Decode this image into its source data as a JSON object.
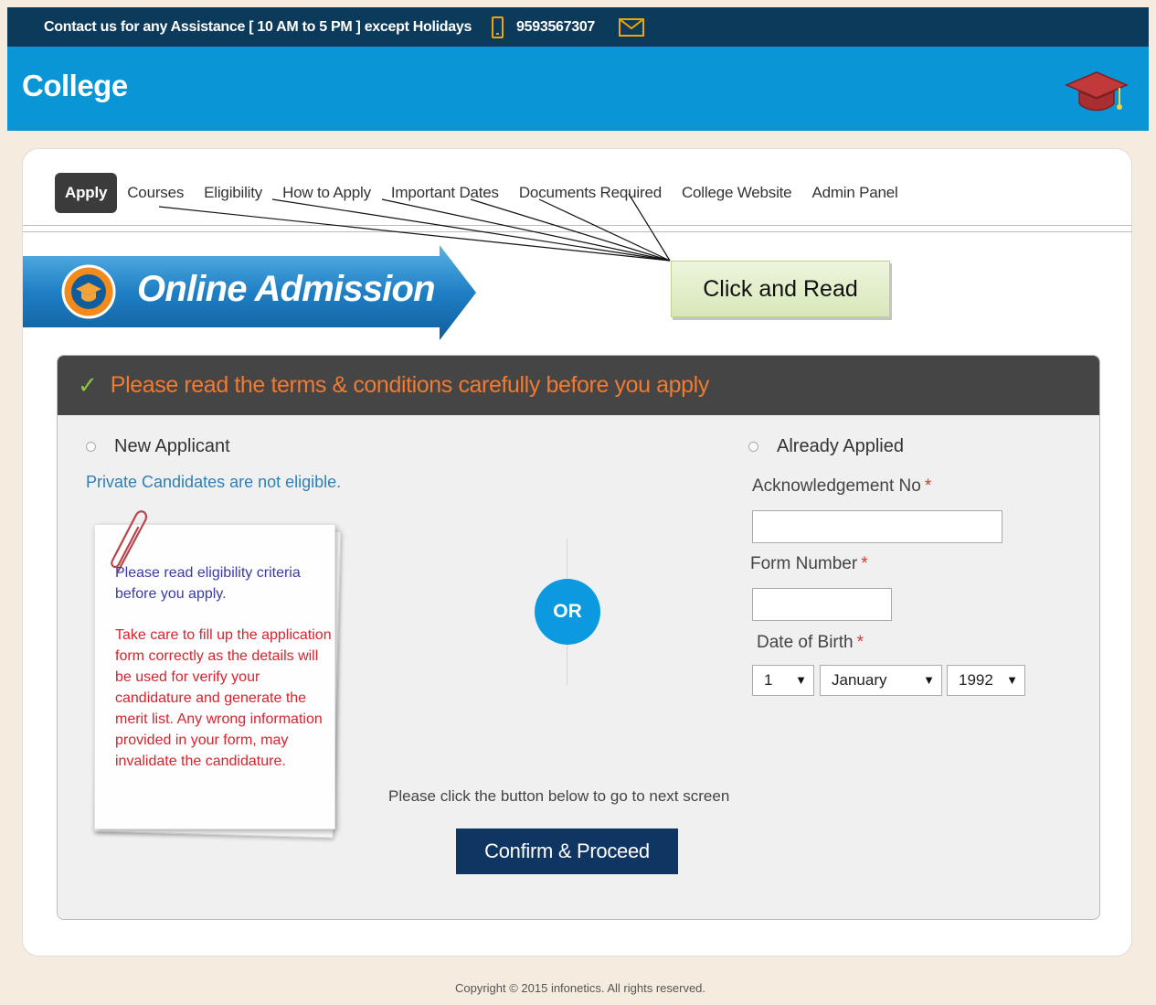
{
  "topbar": {
    "contact_text": "Contact us for any Assistance [ 10 AM to 5 PM ] except Holidays",
    "phone": "9593567307",
    "phone_icon": "mobile-phone-icon",
    "mail_icon": "envelope-icon"
  },
  "header": {
    "brand": "College",
    "logo_icon": "graduation-cap-icon"
  },
  "nav": {
    "items": [
      {
        "label": "Apply",
        "active": true
      },
      {
        "label": "Courses"
      },
      {
        "label": "Eligibility"
      },
      {
        "label": "How to Apply"
      },
      {
        "label": "Important Dates"
      },
      {
        "label": "Documents Required"
      },
      {
        "label": "College Website"
      },
      {
        "label": "Admin Panel"
      }
    ]
  },
  "callout": {
    "text": "Click and Read"
  },
  "banner": {
    "title": "Online Admission"
  },
  "panel": {
    "notice": "Please read the terms & conditions carefully before you apply",
    "new_applicant": {
      "label": "New Applicant",
      "private_note": "Private Candidates are not eligible.",
      "paper_note_1": "Please read eligibility criteria before you apply.",
      "paper_note_2": "Take care to fill up the application form correctly as the details will be used for verify your candidature and generate the merit list. Any wrong information provided in your form, may invalidate the candidature."
    },
    "or_label": "OR",
    "already_applied": {
      "label": "Already Applied",
      "ack_label": "Acknowledgement No",
      "ack_value": "",
      "form_label": "Form Number",
      "form_value": "",
      "dob_label": "Date of Birth",
      "required_mark": "*",
      "dob_day": "1",
      "dob_month": "January",
      "dob_year": "1992"
    },
    "proceed_note": "Please click the button below to go to next screen",
    "confirm_label": "Confirm & Proceed"
  },
  "footer": {
    "copyright": "Copyright © 2015 infonetics. All rights reserved."
  },
  "colors": {
    "topbar": "#0c3a5a",
    "header": "#0a96d6",
    "panel_head": "#454545",
    "notice": "#f07a32",
    "button": "#0f3563",
    "or_badge": "#0b9ae0"
  }
}
